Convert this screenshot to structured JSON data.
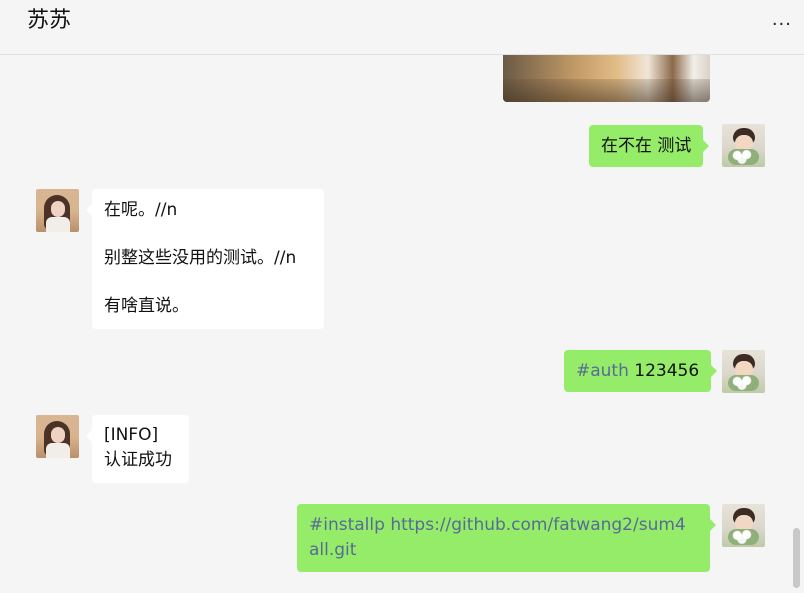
{
  "header": {
    "contact_name": "苏苏",
    "more_icon": "more-icon",
    "more_glyph": "···"
  },
  "messages": [
    {
      "from": "me",
      "type": "image"
    },
    {
      "from": "me",
      "type": "text",
      "text": "在不在 测试"
    },
    {
      "from": "her",
      "type": "text",
      "lines": [
        "在呢。//n",
        "别整这些没用的测试。//n",
        "有啥直说。"
      ]
    },
    {
      "from": "me",
      "type": "text",
      "tag": "#auth",
      "rest": " 123456"
    },
    {
      "from": "her",
      "type": "text",
      "lines": [
        "[INFO]",
        "认证成功"
      ]
    },
    {
      "from": "me",
      "type": "text",
      "lines": [
        "#installp https://github.com/fatwang2/sum4",
        "all.git"
      ]
    }
  ],
  "colors": {
    "my_bubble": "#95ec69",
    "their_bubble": "#ffffff",
    "link": "#576b95",
    "background": "#f5f5f5"
  }
}
